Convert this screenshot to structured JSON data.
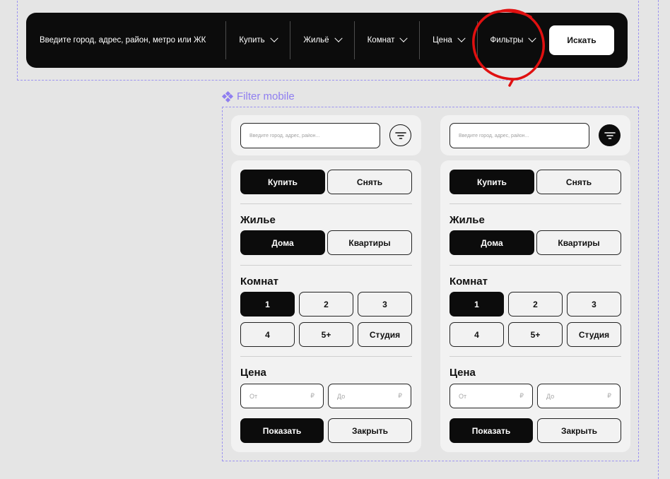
{
  "desktop": {
    "query_placeholder": "Введите город, адрес, район, метро или ЖК",
    "items": [
      "Купить",
      "Жильё",
      "Комнат",
      "Цена",
      "Фильтры"
    ],
    "search_label": "Искать"
  },
  "mobile_label": "Filter mobile",
  "mobile": {
    "search_placeholder": "Введите город, адрес, район...",
    "deal": [
      "Купить",
      "Снять"
    ],
    "housing_title": "Жилье",
    "housing": [
      "Дома",
      "Квартиры"
    ],
    "rooms_title": "Комнат",
    "rooms": [
      "1",
      "2",
      "3",
      "4",
      "5+",
      "Студия"
    ],
    "price_title": "Цена",
    "price_from": "От",
    "price_to": "До",
    "currency": "₽",
    "show_label": "Показать",
    "close_label": "Закрыть"
  },
  "colors": {
    "accent": "#0c0c0c",
    "frame": "#9c93f0",
    "annotation": "#e01010"
  }
}
